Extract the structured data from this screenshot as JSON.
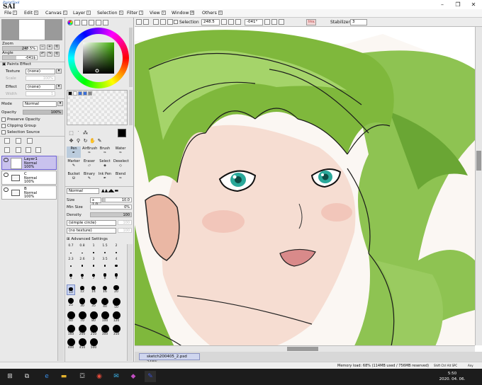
{
  "app": {
    "logo_small": "PaintTool",
    "logo_big": "SAI"
  },
  "menu": [
    {
      "label": "File",
      "key": "F"
    },
    {
      "label": "Edit",
      "key": "E"
    },
    {
      "label": "Canvas",
      "key": "C"
    },
    {
      "label": "Layer",
      "key": "L"
    },
    {
      "label": "Selection",
      "key": "S"
    },
    {
      "label": "Filter",
      "key": "T"
    },
    {
      "label": "View",
      "key": "V"
    },
    {
      "label": "Window",
      "key": "W"
    },
    {
      "label": "Others",
      "key": "O"
    }
  ],
  "window_controls": {
    "minimize": "–",
    "maximize": "❐",
    "close": "✕"
  },
  "navigator": {
    "zoom_label": "Zoom",
    "zoom_value": "248.5%",
    "angle_label": "Angle",
    "angle_value": "-041$"
  },
  "paint_effect": {
    "title": "Paints Effect",
    "texture_label": "Texture",
    "texture_value": "(none)",
    "scale_label": "Scale",
    "scale_value": "100%",
    "effect_label": "Effect",
    "effect_value": "(none)",
    "width_label": "Width",
    "width_value": "1"
  },
  "layer_props": {
    "mode_label": "Mode",
    "mode_value": "Normal",
    "opacity_label": "Opacity",
    "opacity_value": "100%",
    "preserve_opacity": "Preserve Opacity",
    "clipping_group": "Clipping Group",
    "selection_source": "Selection Source"
  },
  "layers": [
    {
      "name": "Layer1",
      "mode": "Normal",
      "opacity": "100%",
      "active": true
    },
    {
      "name": "C",
      "mode": "Normal",
      "opacity": "100%",
      "active": false
    },
    {
      "name": "B",
      "mode": "Normal",
      "opacity": "100%",
      "active": false
    }
  ],
  "tools": {
    "row1": [
      "Pen",
      "AirBrush",
      "Brush",
      "Water"
    ],
    "row2": [
      "Marker",
      "Eraser",
      "Select",
      "Deselect"
    ],
    "row3": [
      "Bucket",
      "Binary",
      "Ink Pen",
      "Blend"
    ]
  },
  "brush": {
    "mode_value": "Normal",
    "size_label": "Size",
    "size_mult": "x 1.0",
    "size_value": "10.0",
    "minsize_label": "Min Size",
    "minsize_value": "0%",
    "density_label": "Density",
    "density_value": "100",
    "shape_value": "(simple circle)",
    "shape_num": "100",
    "texture_value": "(no texture)",
    "texture_num": "100",
    "advanced": "Advanced Settings"
  },
  "size_grid": [
    [
      "0.7",
      "0.8",
      "1",
      "1.5",
      "2"
    ],
    [
      "2.3",
      "2.6",
      "3",
      "3.5",
      "4"
    ],
    [
      "5",
      "6",
      "7",
      "8",
      "9"
    ],
    [
      "10",
      "12",
      "14",
      "16",
      "20"
    ],
    [
      "25",
      "30",
      "35",
      "40",
      "50"
    ],
    [
      "60",
      "70",
      "80",
      "100",
      "120"
    ],
    [
      "160",
      "200",
      "250",
      "300",
      "350"
    ],
    [
      "400",
      "450",
      "500"
    ]
  ],
  "canvas_toolbar": {
    "selection_label": "Selection",
    "zoom_value": "248.5",
    "angle_value": "-041°",
    "invert_label": "Inv.",
    "stabilizer_label": "Stabilizer",
    "stabilizer_value": "3"
  },
  "file_tab": {
    "name": "sketch200405_2.psd",
    "zoom": "248%"
  },
  "status": {
    "memory": "Memory load: 68% (114MB used / 756MB reserved)",
    "keys": "Shift Ctrl Alt SPC",
    "any": "Any"
  },
  "taskbar": {
    "time": "5:50",
    "date": "2020. 04. 06."
  },
  "colors": {
    "accent_layer": "#c9c2ee",
    "hair_green": "#7fb83c",
    "eye_teal": "#2aa89a",
    "taskbar": "#1c1c1c"
  }
}
